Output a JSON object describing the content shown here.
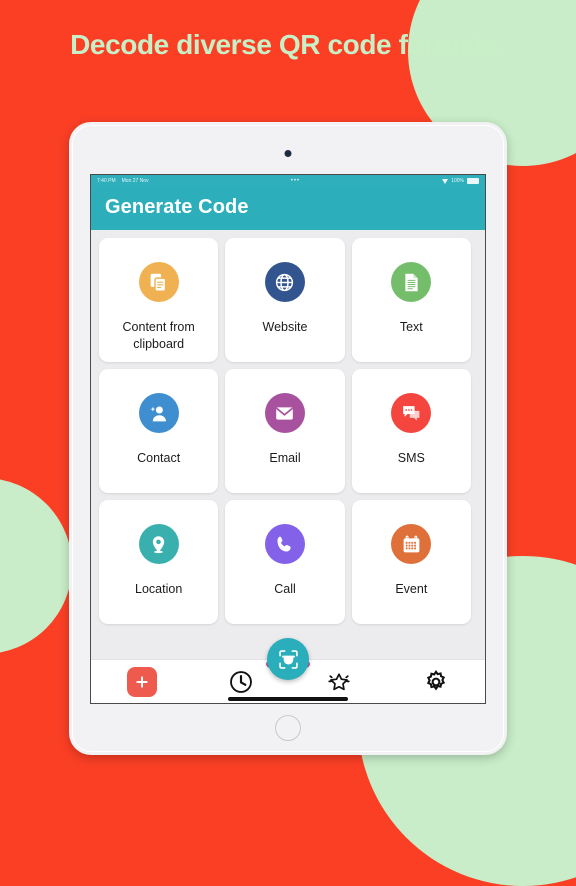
{
  "promo": {
    "headline": "Decode diverse QR code formats.",
    "background_color": "#FA3F25",
    "accent_color": "#C8EDC8"
  },
  "device": {
    "status_bar": {
      "time": "7:40 PM",
      "date": "Mon 27 Nov",
      "center_indicator": "•••",
      "battery_percent": "100%",
      "wifi_icon": "wifi-icon",
      "battery_icon": "battery-full-icon"
    },
    "home_button": "home-button",
    "front_camera": "front-camera"
  },
  "app": {
    "title": "Generate Code",
    "app_bar_color": "#2CAFBB",
    "grid": [
      {
        "label": "Content from clipboard",
        "icon": "clipboard-copy-icon",
        "color": "#EFB152"
      },
      {
        "label": "Website",
        "icon": "globe-icon",
        "color": "#32548F"
      },
      {
        "label": "Text",
        "icon": "document-text-icon",
        "color": "#74BE6B"
      },
      {
        "label": "Contact",
        "icon": "person-add-icon",
        "color": "#3F8FD0"
      },
      {
        "label": "Email",
        "icon": "envelope-icon",
        "color": "#A martin"
      },
      {
        "label": "SMS",
        "icon": "chat-bubble-icon",
        "color": "#F4463F"
      },
      {
        "label": "Location",
        "icon": "map-pin-icon",
        "color": "#3AB0AE"
      },
      {
        "label": "Call",
        "icon": "phone-icon",
        "color": "#8361E8"
      },
      {
        "label": "Event",
        "icon": "calendar-icon",
        "color": "#DF7039"
      }
    ],
    "bottom_nav": [
      {
        "name": "add",
        "icon": "plus-icon",
        "color": "#EE5B4E"
      },
      {
        "name": "history",
        "icon": "clock-icon",
        "color": "#111111"
      },
      {
        "name": "scan",
        "icon": "qr-scan-icon",
        "color": "#2AAEBB"
      },
      {
        "name": "favorites",
        "icon": "star-sparkle-icon",
        "color": "#111111"
      },
      {
        "name": "settings",
        "icon": "gear-icon",
        "color": "#111111"
      }
    ]
  }
}
